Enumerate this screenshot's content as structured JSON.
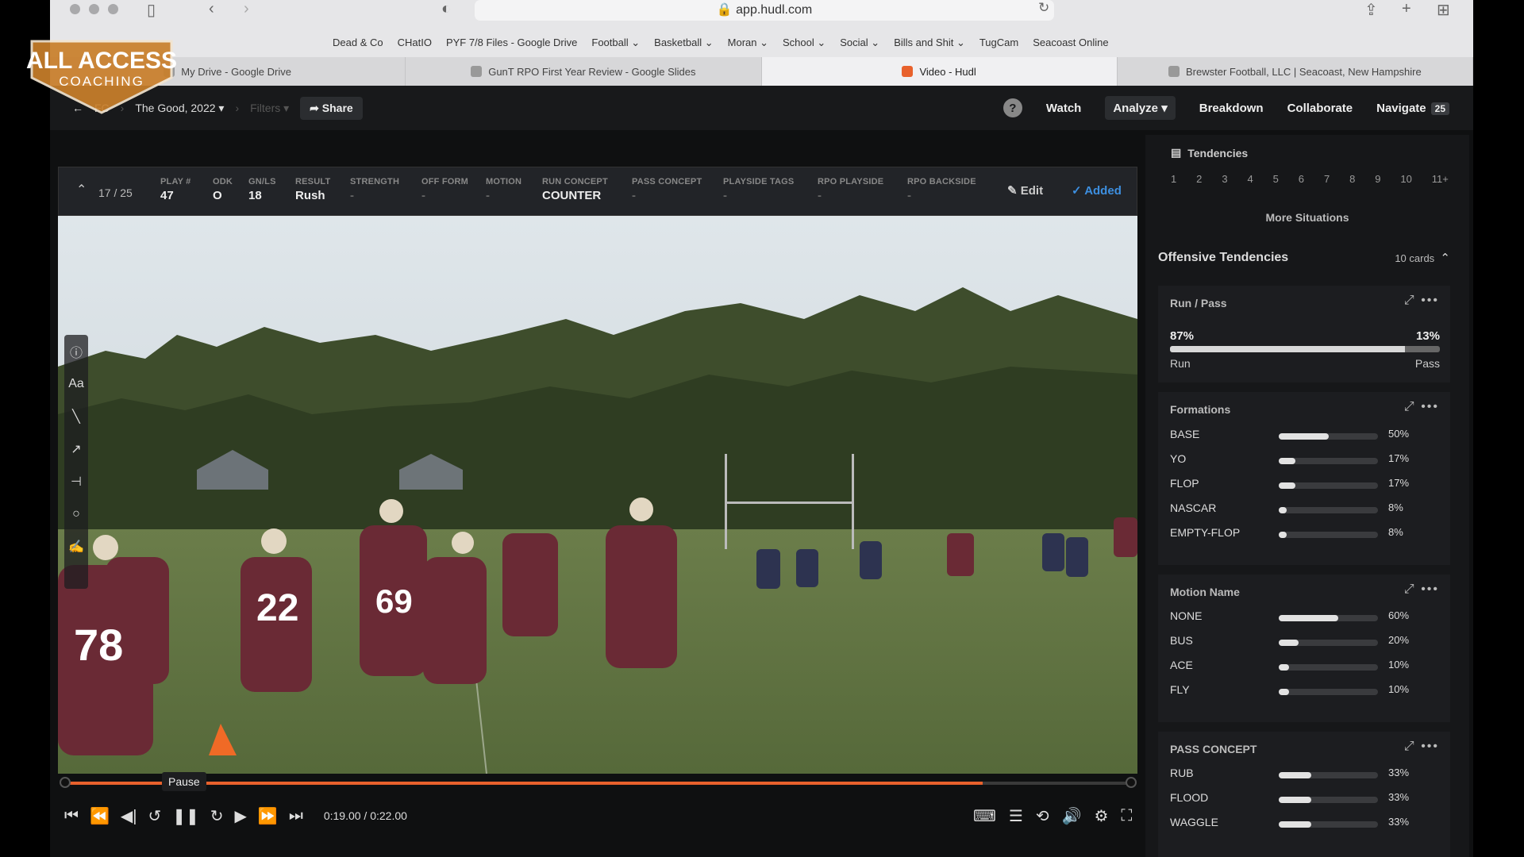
{
  "browser": {
    "url": "app.hudl.com",
    "bookmarks": [
      "Dead & Co",
      "CHatIO",
      "PYF 7/8 Files - Google Drive",
      "Football ⌄",
      "Basketball ⌄",
      "Moran ⌄",
      "School ⌄",
      "Social ⌄",
      "Bills and Shit ⌄",
      "TugCam",
      "Seacoast Online"
    ],
    "tabs": [
      {
        "label": "My Drive - Google Drive",
        "active": false
      },
      {
        "label": "GunT RPO First Year Review - Google Slides",
        "active": false
      },
      {
        "label": "Video - Hudl",
        "active": true
      },
      {
        "label": "Brewster Football, LLC | Seacoast, New Hampshire",
        "active": false
      }
    ]
  },
  "logo": {
    "line1": "ALL ACCESS",
    "line2": "COACHING"
  },
  "header": {
    "crumb_fc": "FC",
    "crumb_title": "The Good, 2022",
    "crumb_filters": "Filters",
    "share": "Share",
    "help": "?",
    "watch": "Watch",
    "analyze": "Analyze",
    "breakdown": "Breakdown",
    "collaborate": "Collaborate",
    "navigate": "Navigate",
    "navigate_count": "25"
  },
  "play": {
    "counter": "17 / 25",
    "fields": [
      {
        "key": "PLAY #",
        "value": "47"
      },
      {
        "key": "ODK",
        "value": "O"
      },
      {
        "key": "GN/LS",
        "value": "18"
      },
      {
        "key": "RESULT",
        "value": "Rush"
      },
      {
        "key": "STRENGTH",
        "value": "-"
      },
      {
        "key": "OFF FORM",
        "value": "-"
      },
      {
        "key": "MOTION",
        "value": "-"
      },
      {
        "key": "RUN CONCEPT",
        "value": "COUNTER"
      },
      {
        "key": "PASS CONCEPT",
        "value": "-"
      },
      {
        "key": "PLAYSIDE TAGS",
        "value": "-"
      },
      {
        "key": "RPO PLAYSIDE",
        "value": "-"
      },
      {
        "key": "RPO BACKSIDE",
        "value": "-"
      }
    ],
    "edit": "Edit",
    "added": "Added"
  },
  "player": {
    "tooltip": "Pause",
    "timecode": "0:19.00 / 0:22.00",
    "progress": 0.86
  },
  "panel": {
    "title": "Tendencies",
    "situations": [
      "1",
      "2",
      "3",
      "4",
      "5",
      "6",
      "7",
      "8",
      "9",
      "10",
      "11+"
    ],
    "more_situations": "More Situations",
    "offensive_title": "Offensive Tendencies",
    "cards_count": "10 cards",
    "run_pass": {
      "title": "Run / Pass",
      "run_pct": "87%",
      "pass_pct": "13%",
      "run_value": 0.87,
      "run_label": "Run",
      "pass_label": "Pass"
    },
    "formations": {
      "title": "Formations",
      "rows": [
        {
          "label": "BASE",
          "pct": "50%",
          "value": 0.5
        },
        {
          "label": "YO",
          "pct": "17%",
          "value": 0.17
        },
        {
          "label": "FLOP",
          "pct": "17%",
          "value": 0.17
        },
        {
          "label": "NASCAR",
          "pct": "8%",
          "value": 0.08
        },
        {
          "label": "EMPTY-FLOP",
          "pct": "8%",
          "value": 0.08
        }
      ]
    },
    "motion": {
      "title": "Motion Name",
      "rows": [
        {
          "label": "NONE",
          "pct": "60%",
          "value": 0.6
        },
        {
          "label": "BUS",
          "pct": "20%",
          "value": 0.2
        },
        {
          "label": "ACE",
          "pct": "10%",
          "value": 0.1
        },
        {
          "label": "FLY",
          "pct": "10%",
          "value": 0.1
        }
      ]
    },
    "pass_concept": {
      "title": "PASS CONCEPT",
      "rows": [
        {
          "label": "RUB",
          "pct": "33%",
          "value": 0.33
        },
        {
          "label": "FLOOD",
          "pct": "33%",
          "value": 0.33
        },
        {
          "label": "WAGGLE",
          "pct": "33%",
          "value": 0.33
        }
      ]
    }
  },
  "colors": {
    "accent": "#e8612c",
    "added": "#3d8fe0",
    "panel": "#161719"
  }
}
